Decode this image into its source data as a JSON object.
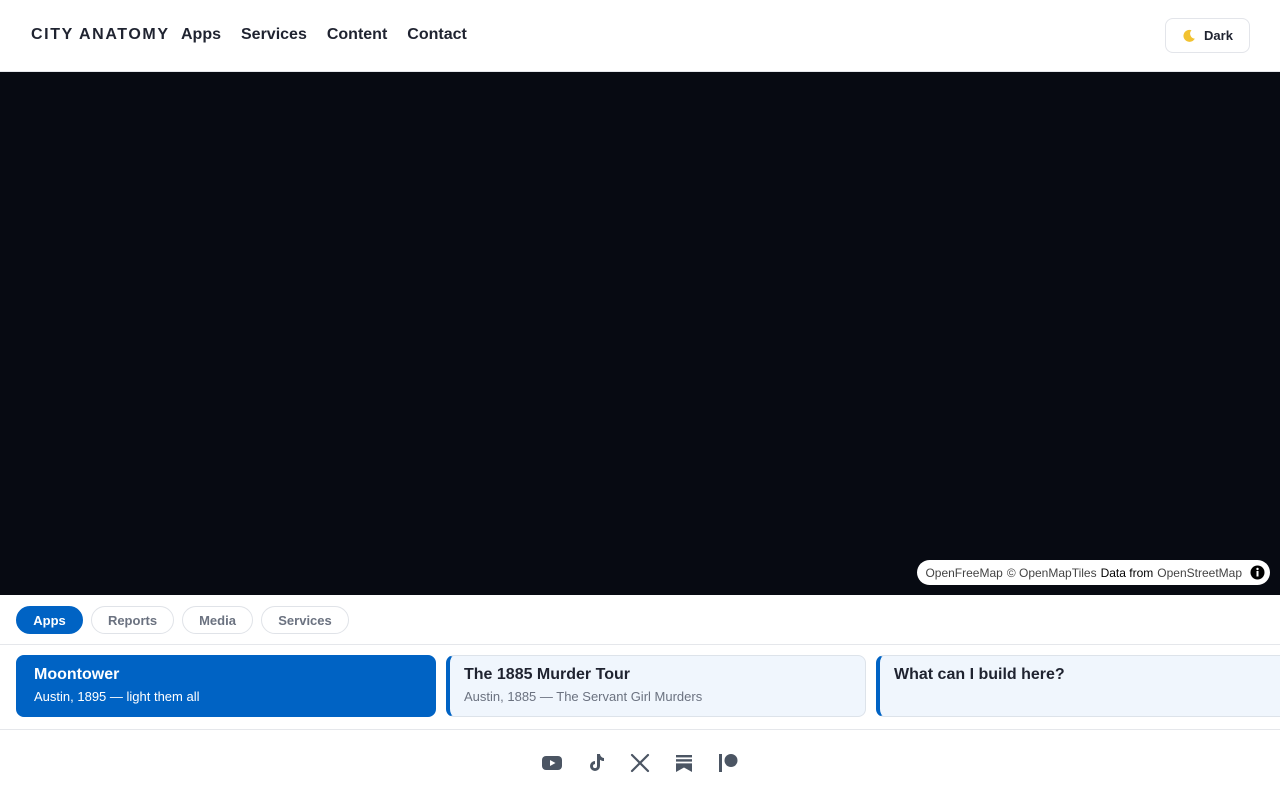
{
  "header": {
    "brand": "CITY ANATOMY",
    "nav": [
      "Apps",
      "Services",
      "Content",
      "Contact"
    ],
    "theme_toggle_label": "Dark"
  },
  "map": {
    "attribution": {
      "openfreemap": "OpenFreeMap",
      "openmaptiles": "© OpenMapTiles",
      "data_from": "Data from",
      "openstreetmap": "OpenStreetMap"
    }
  },
  "tabs": [
    {
      "label": "Apps",
      "active": true
    },
    {
      "label": "Reports",
      "active": false
    },
    {
      "label": "Media",
      "active": false
    },
    {
      "label": "Services",
      "active": false
    }
  ],
  "cards": [
    {
      "title": "Moontower",
      "subtitle": "Austin, 1895 — light them all",
      "active": true
    },
    {
      "title": "The 1885 Murder Tour",
      "subtitle": "Austin, 1885 — The Servant Girl Murders",
      "active": false
    },
    {
      "title": "What can I build here?",
      "subtitle": "",
      "active": false
    }
  ],
  "footer": {
    "social_icons": [
      "youtube-icon",
      "tiktok-icon",
      "x-icon",
      "substack-icon",
      "patreon-icon"
    ]
  },
  "colors": {
    "accent": "#0063c4",
    "map_background": "#070a12",
    "text": "#1f2330",
    "muted": "#6b7280"
  }
}
